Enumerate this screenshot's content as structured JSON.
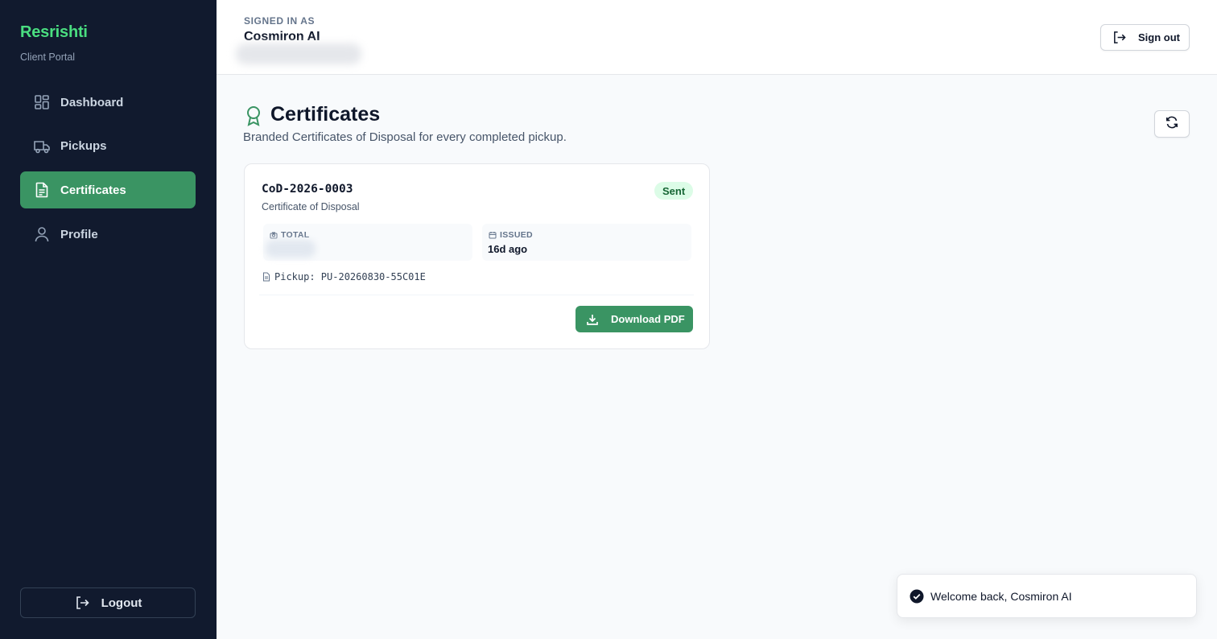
{
  "brand": {
    "name": "Resrishti",
    "subtitle": "Client Portal"
  },
  "sidebar": {
    "items": [
      {
        "label": "Dashboard",
        "icon": "dashboard-icon",
        "active": false
      },
      {
        "label": "Pickups",
        "icon": "truck-icon",
        "active": false
      },
      {
        "label": "Certificates",
        "icon": "document-icon",
        "active": true
      },
      {
        "label": "Profile",
        "icon": "user-icon",
        "active": false
      }
    ],
    "logout_label": "Logout"
  },
  "header": {
    "signed_in_label": "SIGNED IN AS",
    "user_name": "Cosmiron AI",
    "sign_out_label": "Sign out"
  },
  "page": {
    "title": "Certificates",
    "subtitle": "Branded Certificates of Disposal for every completed pickup."
  },
  "certificate": {
    "id": "CoD-2026-0003",
    "type": "Certificate of Disposal",
    "status": "Sent",
    "total_label": "TOTAL",
    "issued_label": "ISSUED",
    "issued_value": "16d ago",
    "pickup": "Pickup: PU-20260830-55C01E",
    "download_label": "Download PDF"
  },
  "toast": {
    "message": "Welcome back, Cosmiron AI"
  },
  "colors": {
    "sidebar_bg": "#111a2e",
    "brand_green": "#4ade80",
    "accent_green": "#3a9463",
    "badge_bg": "#dcfce7"
  }
}
